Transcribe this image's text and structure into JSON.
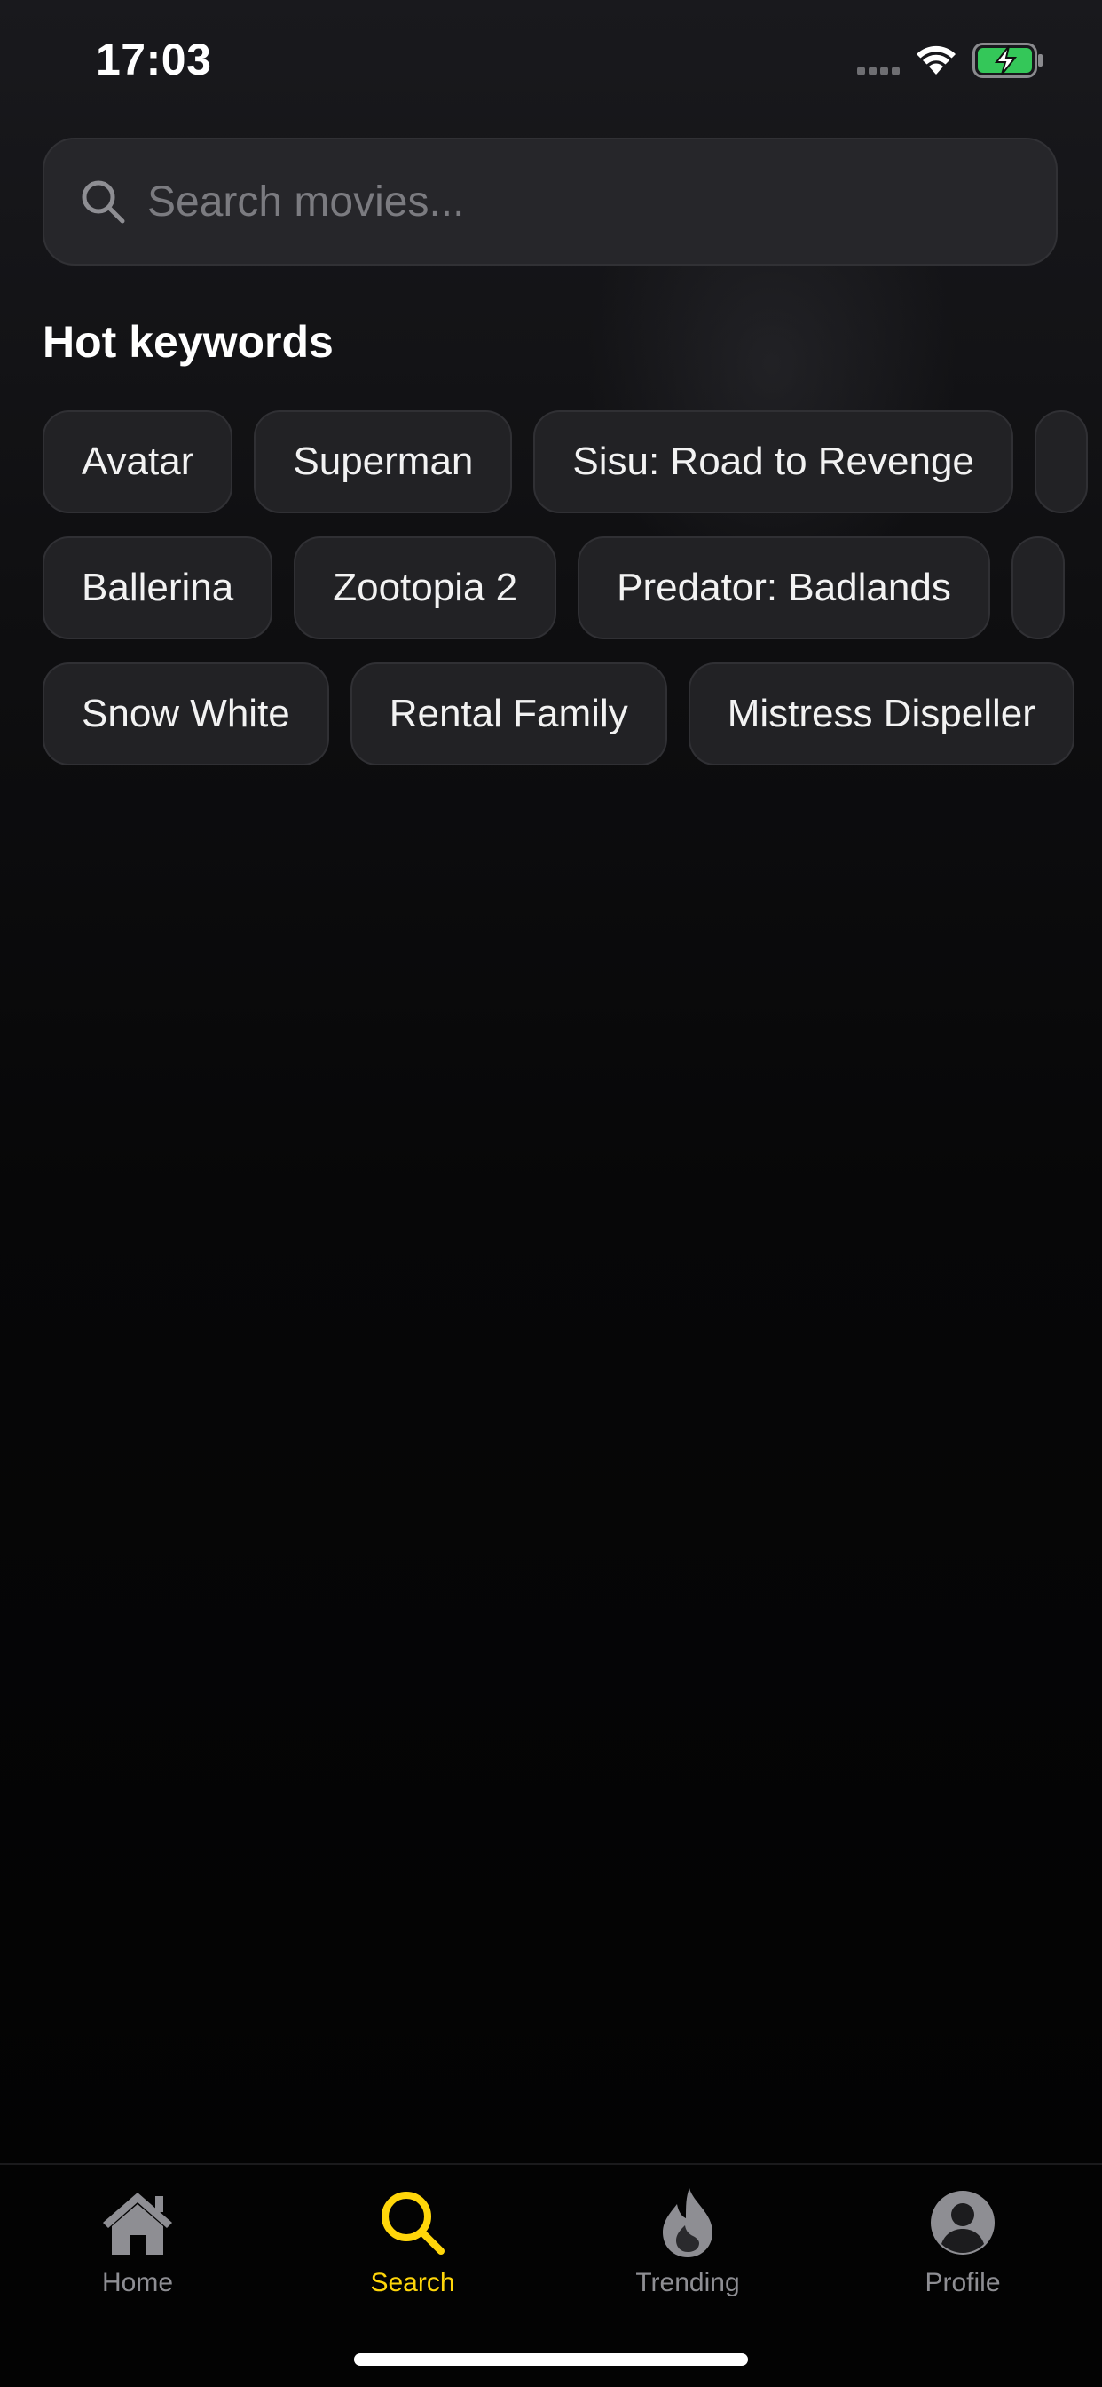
{
  "status_bar": {
    "time": "17:03"
  },
  "search": {
    "placeholder": "Search movies..."
  },
  "section": {
    "title": "Hot keywords"
  },
  "keywords": {
    "row1": [
      "Avatar",
      "Superman",
      "Sisu: Road to Revenge"
    ],
    "row2": [
      "Ballerina",
      "Zootopia 2",
      "Predator: Badlands"
    ],
    "row3": [
      "Snow White",
      "Rental Family",
      "Mistress Dispeller"
    ]
  },
  "tabs": [
    {
      "label": "Home",
      "icon": "house-icon",
      "active": false
    },
    {
      "label": "Search",
      "icon": "search-icon",
      "active": true
    },
    {
      "label": "Trending",
      "icon": "flame-icon",
      "active": false
    },
    {
      "label": "Profile",
      "icon": "person-icon",
      "active": false
    }
  ],
  "colors": {
    "accent": "#ffd60a",
    "inactive": "#8e8e93",
    "battery": "#34c759"
  }
}
